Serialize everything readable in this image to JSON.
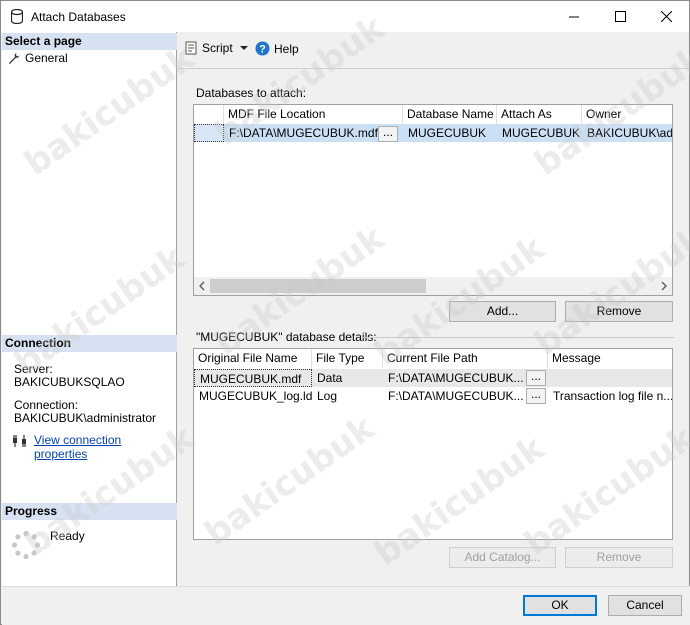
{
  "window": {
    "title": "Attach Databases"
  },
  "left": {
    "select_page_header": "Select a page",
    "nav_items": [
      {
        "label": "General",
        "icon": "wrench-icon"
      }
    ],
    "connection_header": "Connection",
    "server_label": "Server:",
    "server_value": "BAKICUBUKSQLAO",
    "connection_label": "Connection:",
    "connection_value": "BAKICUBUK\\administrator",
    "view_link": "View connection properties",
    "progress_header": "Progress",
    "progress_status": "Ready"
  },
  "toolbar": {
    "script_label": "Script",
    "help_label": "Help"
  },
  "attach": {
    "label": "Databases to attach:",
    "columns": [
      "MDF File Location",
      "Database Name",
      "Attach As",
      "Owner"
    ],
    "rows": [
      {
        "mdf": "F:\\DATA\\MUGECUBUK.mdf",
        "db_name": "MUGECUBUK",
        "attach_as": "MUGECUBUK",
        "owner": "BAKICUBUK\\adm"
      }
    ],
    "browse_label": "...",
    "add_button": "Add...",
    "remove_button": "Remove"
  },
  "details": {
    "label": "\"MUGECUBUK\" database details:",
    "columns": [
      "Original File Name",
      "File Type",
      "Current File Path",
      "Message"
    ],
    "rows": [
      {
        "name": "MUGECUBUK.mdf",
        "type": "Data",
        "path": "F:\\DATA\\MUGECUBUK...",
        "message": ""
      },
      {
        "name": "MUGECUBUK_log.ldf",
        "type": "Log",
        "path": "F:\\DATA\\MUGECUBUK...",
        "message": "Transaction log file n..."
      }
    ],
    "browse_label": "...",
    "add_catalog_button": "Add Catalog...",
    "remove_button": "Remove"
  },
  "footer": {
    "ok_button": "OK",
    "cancel_button": "Cancel"
  },
  "watermark": "bakicubuk",
  "colors": {
    "section_header": "#d6e2f1",
    "selection": "#cce0f5",
    "link": "#0645ad",
    "accent": "#0078d7"
  }
}
